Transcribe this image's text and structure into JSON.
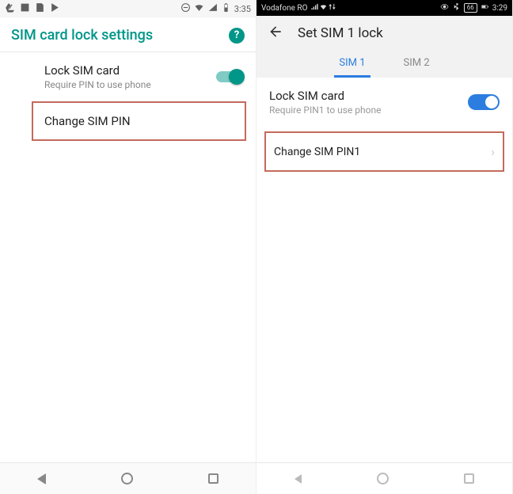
{
  "left": {
    "status": {
      "time": "3:35"
    },
    "header": {
      "title": "SIM card lock settings",
      "help_glyph": "?"
    },
    "lock_item": {
      "title": "Lock SIM card",
      "subtitle": "Require PIN to use phone"
    },
    "change_item": {
      "title": "Change SIM PIN"
    }
  },
  "right": {
    "status": {
      "carrier": "Vodafone RO",
      "battery": "66",
      "time": "3:29"
    },
    "header": {
      "title": "Set SIM 1 lock"
    },
    "tabs": {
      "sim1": "SIM 1",
      "sim2": "SIM 2"
    },
    "lock_item": {
      "title": "Lock SIM card",
      "subtitle": "Require PIN1 to use phone"
    },
    "change_item": {
      "title": "Change SIM PIN1"
    }
  }
}
